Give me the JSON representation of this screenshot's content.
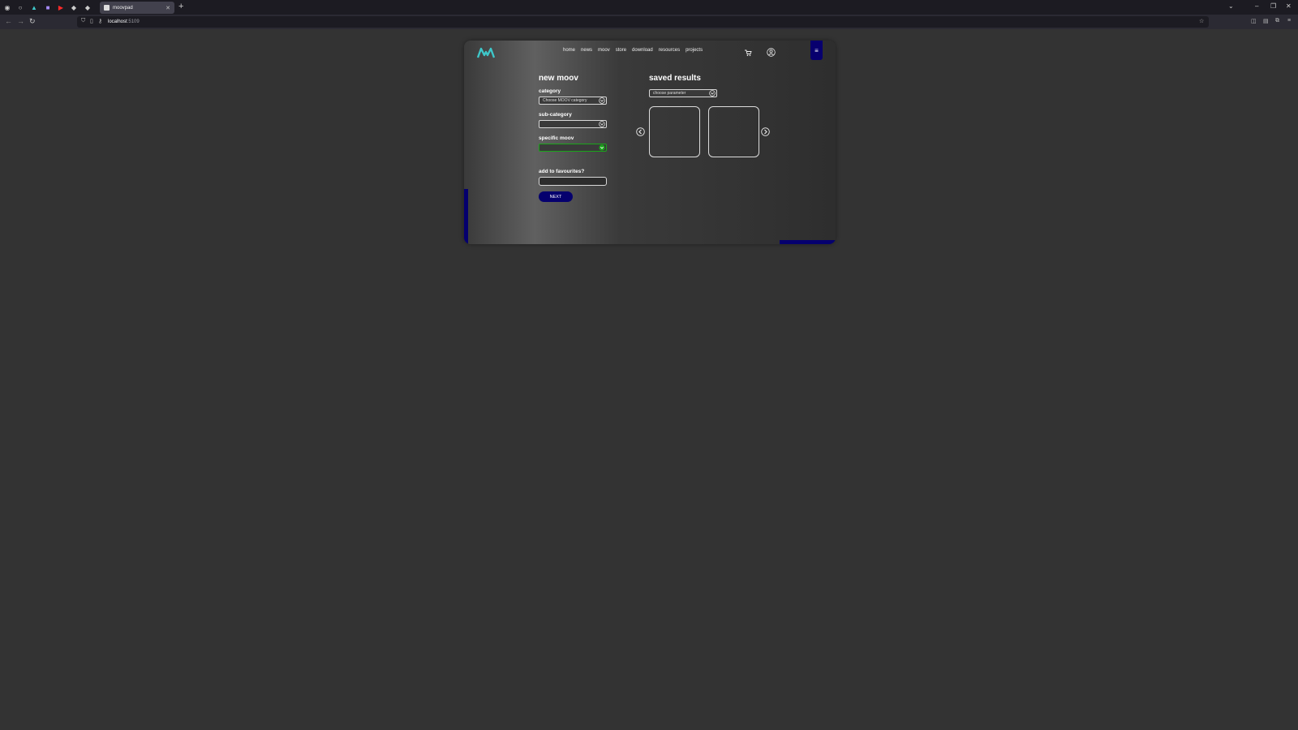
{
  "browser": {
    "active_tab_title": "moovpad",
    "url_host": "localhost",
    "url_port": ":5109",
    "pinned_tabs": [
      "shield-icon",
      "github-icon",
      "moovpad-icon",
      "purple-app-icon",
      "youtube-icon",
      "badge-icon",
      "badge-icon-2"
    ]
  },
  "app": {
    "nav": [
      "home",
      "news",
      "moov",
      "store",
      "download",
      "resources",
      "projects"
    ],
    "form": {
      "title": "new moov",
      "category_label": "category",
      "category_value": "Choose MOOV category",
      "subcategory_label": "sub-category",
      "subcategory_value": "",
      "specific_label": "specific moov",
      "specific_value": "",
      "favourites_label": "add to favourites?",
      "favourites_value": "",
      "next_label": "NEXT"
    },
    "saved": {
      "title": "saved results",
      "param_value": "choose parameter"
    }
  },
  "colors": {
    "accent_navy": "#05006e",
    "logo_teal": "#3ec7c9",
    "valid_green": "#1aa51a"
  }
}
